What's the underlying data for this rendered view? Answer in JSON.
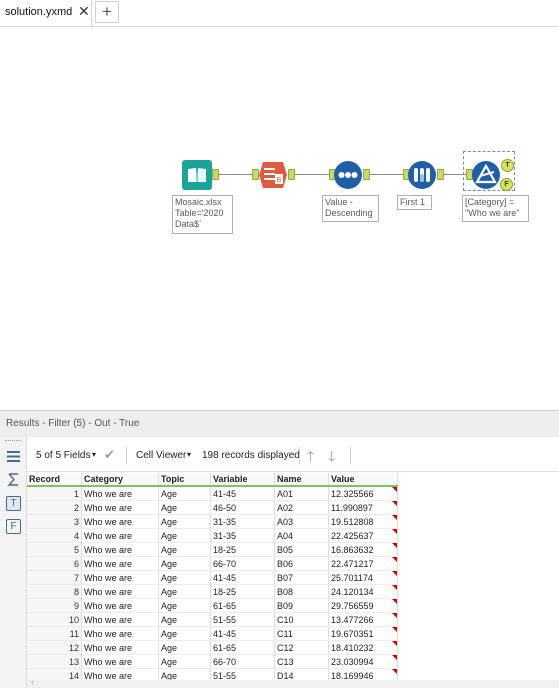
{
  "tab": {
    "title": "solution.yxmd",
    "close": "✕",
    "add": "+"
  },
  "workflow": {
    "tools": [
      {
        "name": "input-data-tool",
        "icon": "book-icon",
        "note": "Mosaic.xlsx\nTable='2020\nData$`"
      },
      {
        "name": "select-tool",
        "icon": "select-icon",
        "note": ""
      },
      {
        "name": "sort-tool",
        "icon": "sort-dots-icon",
        "note": "Value -\nDescending"
      },
      {
        "name": "sample-tool",
        "icon": "sample-icon",
        "note": "First 1"
      },
      {
        "name": "filter-tool",
        "icon": "filter-icon",
        "note": "[Category] =\n\"Who we are\""
      }
    ],
    "true_label": "T",
    "false_label": "F"
  },
  "results": {
    "title": "Results - Filter (5) - Out - True",
    "fields_label": "5 of 5 Fields",
    "viewer_label": "Cell Viewer",
    "records_label": "198 records displayed",
    "rail": {
      "table": "T",
      "filter": "F"
    },
    "columns": [
      "Record",
      "Category",
      "Topic",
      "Variable",
      "Name",
      "Value"
    ],
    "rows": [
      [
        "1",
        "Who we are",
        "Age",
        "41-45",
        "A01",
        "12.325566"
      ],
      [
        "2",
        "Who we are",
        "Age",
        "46-50",
        "A02",
        "11.990897"
      ],
      [
        "3",
        "Who we are",
        "Age",
        "31-35",
        "A03",
        "19.512808"
      ],
      [
        "4",
        "Who we are",
        "Age",
        "31-35",
        "A04",
        "22.425637"
      ],
      [
        "5",
        "Who we are",
        "Age",
        "18-25",
        "B05",
        "16.863632"
      ],
      [
        "6",
        "Who we are",
        "Age",
        "66-70",
        "B06",
        "22.471217"
      ],
      [
        "7",
        "Who we are",
        "Age",
        "41-45",
        "B07",
        "25.701174"
      ],
      [
        "8",
        "Who we are",
        "Age",
        "18-25",
        "B08",
        "24.120134"
      ],
      [
        "9",
        "Who we are",
        "Age",
        "61-65",
        "B09",
        "29.756559"
      ],
      [
        "10",
        "Who we are",
        "Age",
        "51-55",
        "C10",
        "13.477266"
      ],
      [
        "11",
        "Who we are",
        "Age",
        "41-45",
        "C11",
        "19.670351"
      ],
      [
        "12",
        "Who we are",
        "Age",
        "61-65",
        "C12",
        "18.410232"
      ],
      [
        "13",
        "Who we are",
        "Age",
        "66-70",
        "C13",
        "23.030994"
      ],
      [
        "14",
        "Who we are",
        "Age",
        "51-55",
        "D14",
        "18.169946"
      ]
    ]
  },
  "colors": {
    "input": "#1aa396",
    "select": "#e05a3f",
    "sort": "#1f5fa8",
    "sample": "#1f5fa8",
    "filter": "#1f5fa8",
    "anchor": "#c6d96a",
    "header_rule": "#7fc35a",
    "flag": "#d40000"
  }
}
